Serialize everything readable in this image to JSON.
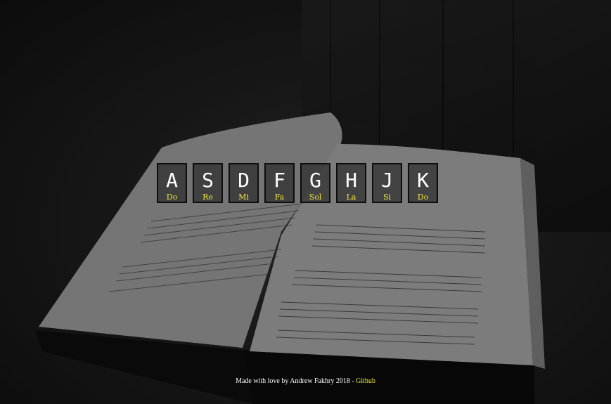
{
  "keys": [
    {
      "letter": "A",
      "note": "Do"
    },
    {
      "letter": "S",
      "note": "Re"
    },
    {
      "letter": "D",
      "note": "Mi"
    },
    {
      "letter": "F",
      "note": "Fa"
    },
    {
      "letter": "G",
      "note": "Sol"
    },
    {
      "letter": "H",
      "note": "La"
    },
    {
      "letter": "J",
      "note": "Si"
    },
    {
      "letter": "K",
      "note": "Do"
    }
  ],
  "footer": {
    "text": "Made with love by Andrew Fakhry 2018 - ",
    "link_label": "Github"
  },
  "colors": {
    "accent": "#f2e63a",
    "text": "#ffffff"
  }
}
